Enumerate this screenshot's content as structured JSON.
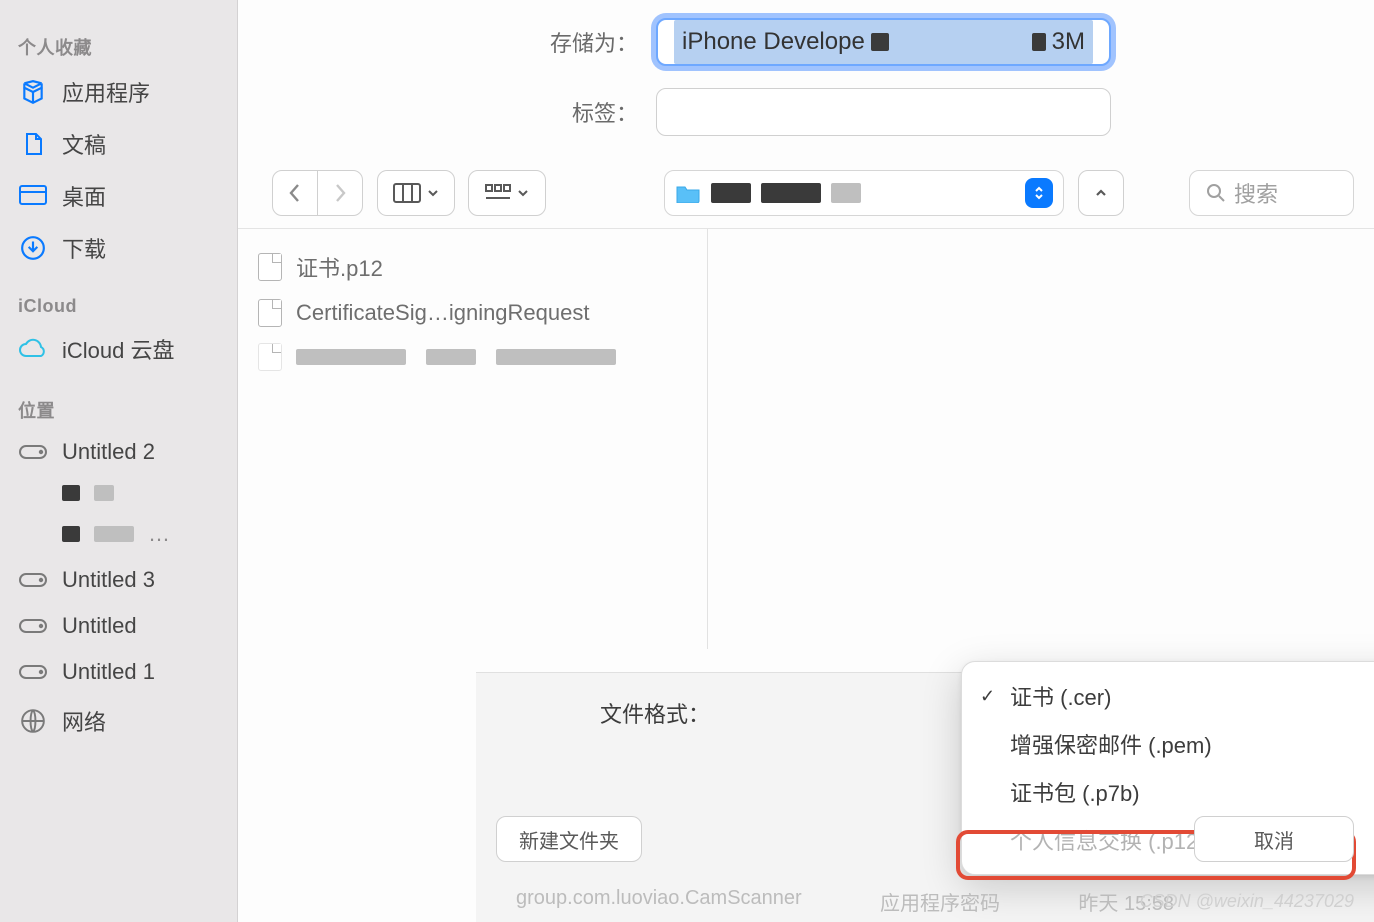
{
  "sidebar": {
    "sections": {
      "favorites": {
        "title": "个人收藏",
        "items": [
          "应用程序",
          "文稿",
          "桌面",
          "下载"
        ]
      },
      "icloud": {
        "title": "iCloud",
        "items": [
          "iCloud 云盘"
        ]
      },
      "locations": {
        "title": "位置",
        "items": [
          "Untitled 2",
          "",
          "",
          "Untitled 3",
          "Untitled",
          "Untitled 1",
          "网络"
        ]
      }
    }
  },
  "form": {
    "save_as_label": "存储为：",
    "save_as_value_prefix": "iPhone Develope",
    "save_as_value_suffix": "3M",
    "tags_label": "标签：",
    "tags_value": ""
  },
  "toolbar": {
    "folder_name": "",
    "search_placeholder": "搜索"
  },
  "files": [
    "证书.p12",
    "CertificateSig…igningRequest",
    ""
  ],
  "file_format": {
    "label": "文件格式：",
    "options": [
      {
        "label": "证书 (.cer)",
        "checked": true,
        "disabled": false
      },
      {
        "label": "增强保密邮件 (.pem)",
        "checked": false,
        "disabled": false
      },
      {
        "label": "证书包 (.p7b)",
        "checked": false,
        "disabled": false
      },
      {
        "label": "个人信息交换 (.p12)",
        "checked": false,
        "disabled": true
      }
    ]
  },
  "buttons": {
    "new_folder": "新建文件夹",
    "cancel": "取消"
  },
  "watermark": "CSDN @weixin_44237029",
  "behind": {
    "a": "group.com.luoviao.CamScanner",
    "b": "应用程序密码",
    "c": "昨天 15:58"
  }
}
